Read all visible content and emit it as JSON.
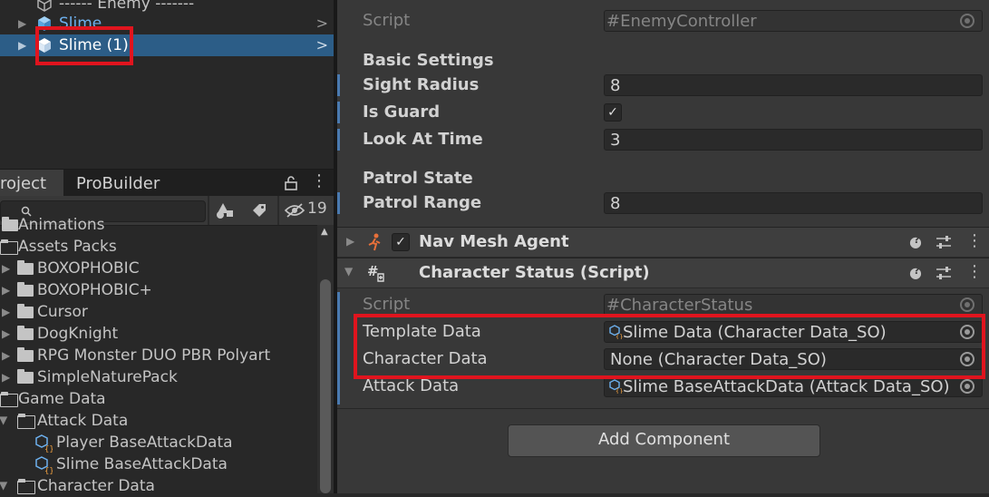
{
  "hierarchy": {
    "items": [
      {
        "label": "------ Enemy -------"
      },
      {
        "label": "Slime"
      },
      {
        "label": "Slime (1)"
      }
    ]
  },
  "project": {
    "tabs": [
      {
        "label": "roject"
      },
      {
        "label": "ProBuilder"
      }
    ],
    "hidden_count": "19",
    "tree": [
      {
        "label": "Animations"
      },
      {
        "label": "Assets Packs"
      },
      {
        "label": "BOXOPHOBIC"
      },
      {
        "label": "BOXOPHOBIC+"
      },
      {
        "label": "Cursor"
      },
      {
        "label": "DogKnight"
      },
      {
        "label": "RPG Monster DUO PBR Polyart"
      },
      {
        "label": "SimpleNaturePack"
      },
      {
        "label": "Game Data"
      },
      {
        "label": "Attack Data"
      },
      {
        "label": "Player BaseAttackData"
      },
      {
        "label": "Slime BaseAttackData"
      },
      {
        "label": "Character Data"
      }
    ]
  },
  "inspector": {
    "enemy_controller": {
      "script_label": "Script",
      "script_value": "EnemyController",
      "section_basic": "Basic Settings",
      "sight_radius_label": "Sight Radius",
      "sight_radius_value": "8",
      "is_guard_label": "Is Guard",
      "look_at_time_label": "Look At Time",
      "look_at_time_value": "3",
      "section_patrol": "Patrol State",
      "patrol_range_label": "Patrol Range",
      "patrol_range_value": "8"
    },
    "nav_mesh_agent": {
      "title": "Nav Mesh Agent"
    },
    "character_status": {
      "title": "Character Status (Script)",
      "script_label": "Script",
      "script_value": "CharacterStatus",
      "template_label": "Template Data",
      "template_value": "Slime Data (Character Data_SO)",
      "character_label": "Character Data",
      "character_value": "None (Character Data_SO)",
      "attack_label": "Attack Data",
      "attack_value": "Slime BaseAttackData (Attack Data_SO)"
    },
    "add_component_label": "Add Component"
  },
  "colors": {
    "highlight": "#e0141e",
    "selection": "#2c5d87",
    "accent": "#4a7ab0"
  }
}
